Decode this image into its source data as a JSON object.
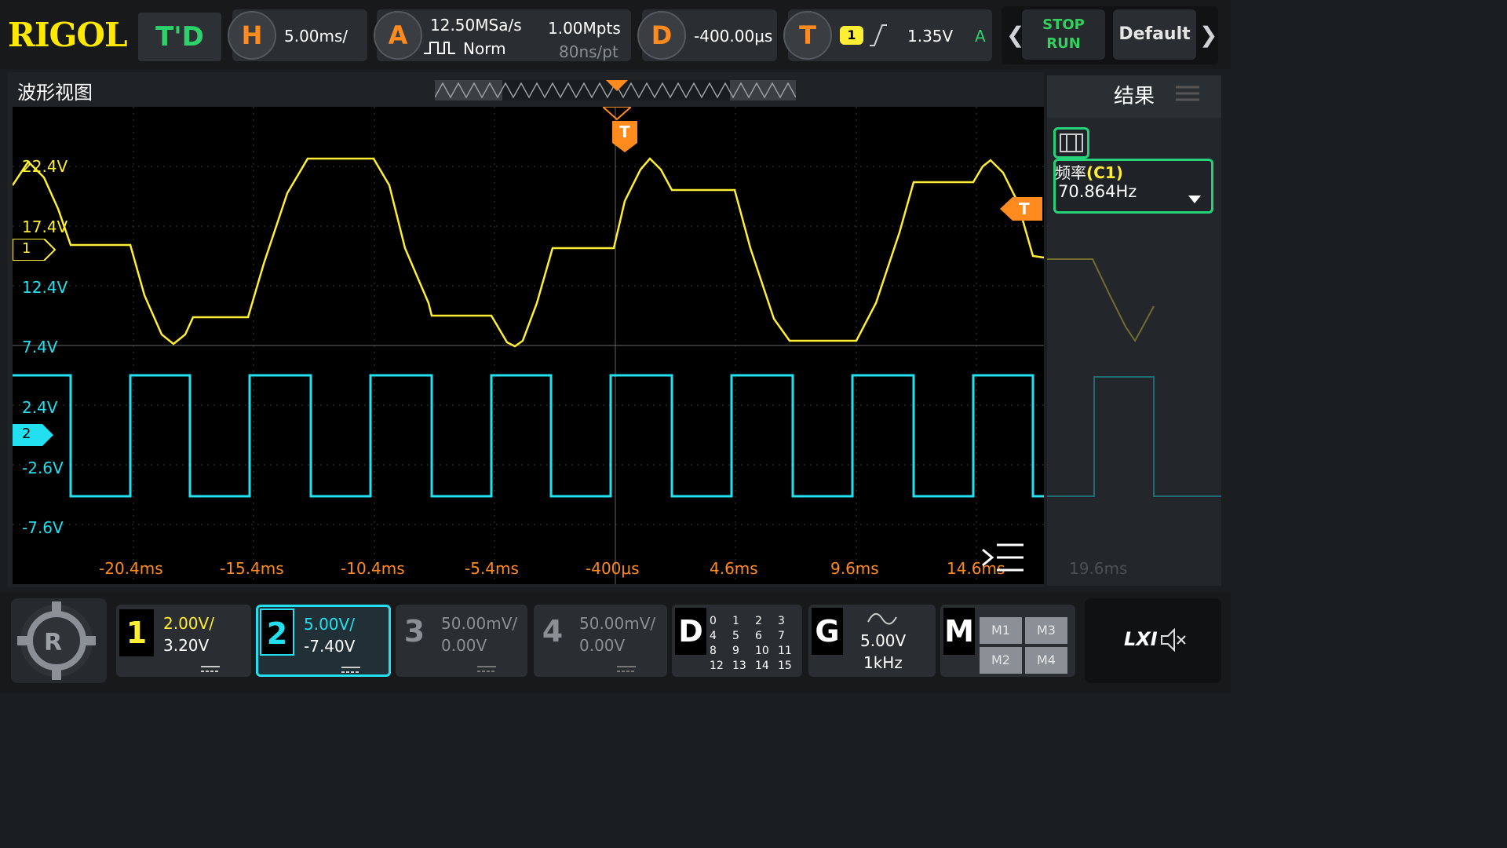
{
  "brand": "RIGOL",
  "mode_button": "T'D",
  "horizontal": {
    "key": "H",
    "scale": "5.00ms/"
  },
  "acquire": {
    "key": "A",
    "sample_rate": "12.50MSa/s",
    "mode": "Norm",
    "memory": "1.00Mpts",
    "per_point": "80ns/pt"
  },
  "delay": {
    "key": "D",
    "value": "-400.00μs"
  },
  "trigger": {
    "key": "T",
    "source": "1",
    "level": "1.35V",
    "sweep": "A"
  },
  "run_control": {
    "stop": "STOP",
    "run": "RUN"
  },
  "default_button": "Default",
  "waveform_view": {
    "title": "波形视图",
    "trigger_marker": "T",
    "volt_labels": [
      "22.4V",
      "17.4V",
      "12.4V",
      "7.4V",
      "2.4V",
      "-2.6V",
      "-7.6V"
    ],
    "time_labels": [
      "-20.4ms",
      "-15.4ms",
      "-10.4ms",
      "-5.4ms",
      "-400μs",
      "4.6ms",
      "9.6ms",
      "14.6ms"
    ],
    "faded_time_label": "19.6ms",
    "ch1_marker": "1",
    "ch2_marker": "2"
  },
  "results": {
    "title": "结果",
    "measure_name": "频率",
    "measure_src": "(C1)",
    "measure_value": "70.864Hz"
  },
  "channels": [
    {
      "num": "1",
      "scale": "2.00V/",
      "offset": "3.20V",
      "color": "#ffee33"
    },
    {
      "num": "2",
      "scale": "5.00V/",
      "offset": "-7.40V",
      "color": "#22e0f0"
    },
    {
      "num": "3",
      "scale": "50.00mV/",
      "offset": "0.00V",
      "color": "#8a8f95"
    },
    {
      "num": "4",
      "scale": "50.00mV/",
      "offset": "0.00V",
      "color": "#8a8f95"
    }
  ],
  "digital": {
    "key": "D",
    "bits": [
      "0",
      "1",
      "2",
      "3",
      "4",
      "5",
      "6",
      "7",
      "8",
      "9",
      "10",
      "11",
      "12",
      "13",
      "14",
      "15"
    ]
  },
  "generator": {
    "key": "G",
    "amplitude": "5.00V",
    "freq": "1kHz"
  },
  "math": {
    "key": "M",
    "items": [
      "M1",
      "M3",
      "M2",
      "M4"
    ]
  },
  "lxi": "LXI",
  "colors": {
    "ch1": "#ffee33",
    "ch2": "#22e0f0",
    "accent": "#ff8a1e",
    "green": "#2dd36a"
  }
}
